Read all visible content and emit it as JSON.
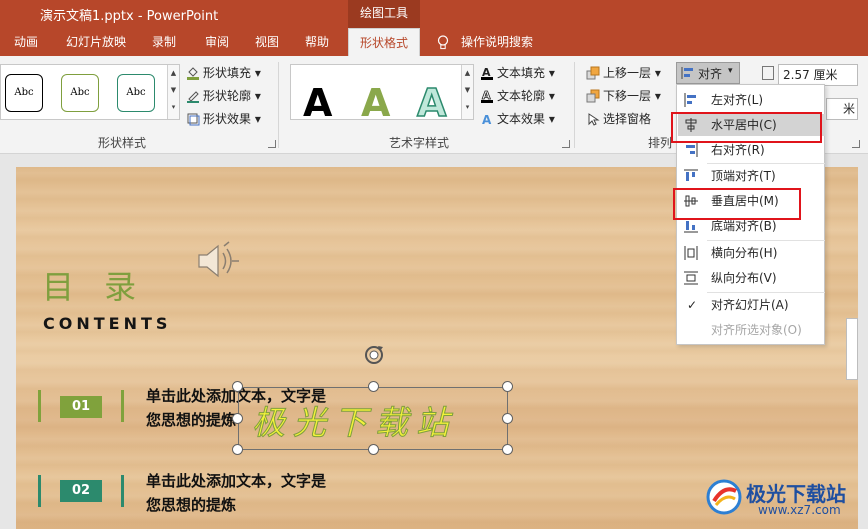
{
  "titlebar": {
    "document": "演示文稿1.pptx  -  PowerPoint",
    "context_tab": "绘图工具"
  },
  "tabs": [
    {
      "label": "动画"
    },
    {
      "label": "幻灯片放映"
    },
    {
      "label": "录制"
    },
    {
      "label": "审阅"
    },
    {
      "label": "视图"
    },
    {
      "label": "帮助"
    },
    {
      "label": "形状格式"
    },
    {
      "label": "操作说明搜索"
    }
  ],
  "ribbon": {
    "shape_styles": {
      "swatches": [
        "Abc",
        "Abc",
        "Abc"
      ],
      "fill": "形状填充",
      "outline": "形状轮廓",
      "effects": "形状效果",
      "label": "形状样式"
    },
    "wordart": {
      "letters": [
        "A",
        "A",
        "A"
      ],
      "fill": "文本填充",
      "outline": "文本轮廓",
      "effects": "文本效果",
      "label": "艺术字样式"
    },
    "arrange": {
      "bring_forward": "上移一层",
      "send_backward": "下移一层",
      "selection_pane": "选择窗格",
      "align": "对齐",
      "label": "排列"
    },
    "size": {
      "height": "2.57 厘米",
      "width_unit": "米"
    }
  },
  "align_menu": {
    "items": [
      {
        "label": "左对齐(L)"
      },
      {
        "label": "水平居中(C)"
      },
      {
        "label": "右对齐(R)"
      },
      {
        "label": "顶端对齐(T)"
      },
      {
        "label": "垂直居中(M)"
      },
      {
        "label": "底端对齐(B)"
      },
      {
        "label": "横向分布(H)"
      },
      {
        "label": "纵向分布(V)"
      },
      {
        "label": "对齐幻灯片(A)"
      },
      {
        "label": "对齐所选对象(O)"
      }
    ],
    "check": "✓"
  },
  "slide": {
    "title": "目 录",
    "subtitle": "CONTENTS",
    "item1_number": "01",
    "item1_text_line1": "单击此处添加文本，文字是",
    "item1_text_line2": "您思想的提炼",
    "item2_number": "02",
    "item2_text_line1": "单击此处添加文本，文字是",
    "item2_text_line2": "您思想的提炼",
    "selected_text": "极光下载站"
  },
  "watermark": {
    "name": "极光下载站",
    "url": "www.xz7.com"
  },
  "colors": {
    "brand": "#b7472a",
    "title_green": "#7f9f3e",
    "item1_green": "#80a23c",
    "item2_teal": "#2c8a6d",
    "highlight_red": "#e0141b",
    "selected_text_yellow": "#f2f23a"
  }
}
